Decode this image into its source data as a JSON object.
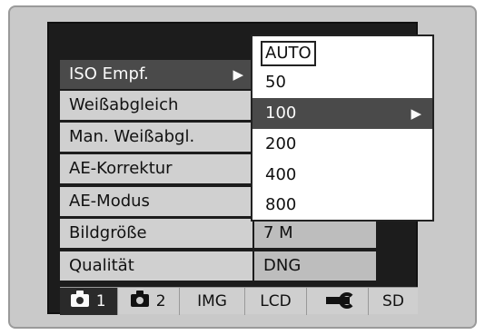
{
  "menu": {
    "items": [
      {
        "label": "ISO Empf.",
        "selected": true
      },
      {
        "label": "Weißabgleich"
      },
      {
        "label": "Man. Weißabgl."
      },
      {
        "label": "AE-Korrektur"
      },
      {
        "label": "AE-Modus"
      },
      {
        "label": "Bildgröße",
        "value": "7 M"
      },
      {
        "label": "Qualität",
        "value": "DNG"
      }
    ],
    "submenu_arrow": "▶"
  },
  "iso_popup": {
    "options": [
      "AUTO",
      "50",
      "100",
      "200",
      "400",
      "800"
    ],
    "boxed_option": "AUTO",
    "selected_option": "100"
  },
  "tabs": [
    {
      "label": "1",
      "icon": "camera-icon",
      "active": true
    },
    {
      "label": "2",
      "icon": "camera-icon"
    },
    {
      "label": "IMG"
    },
    {
      "label": "LCD"
    },
    {
      "label": "",
      "icon": "wrench-icon"
    },
    {
      "label": "SD"
    }
  ],
  "colors": {
    "selected_row": "#4a4a4a",
    "menu_bg": "#d0d0d0",
    "popup_bg": "#ffffff",
    "screen_bg": "#1c1c1c"
  }
}
